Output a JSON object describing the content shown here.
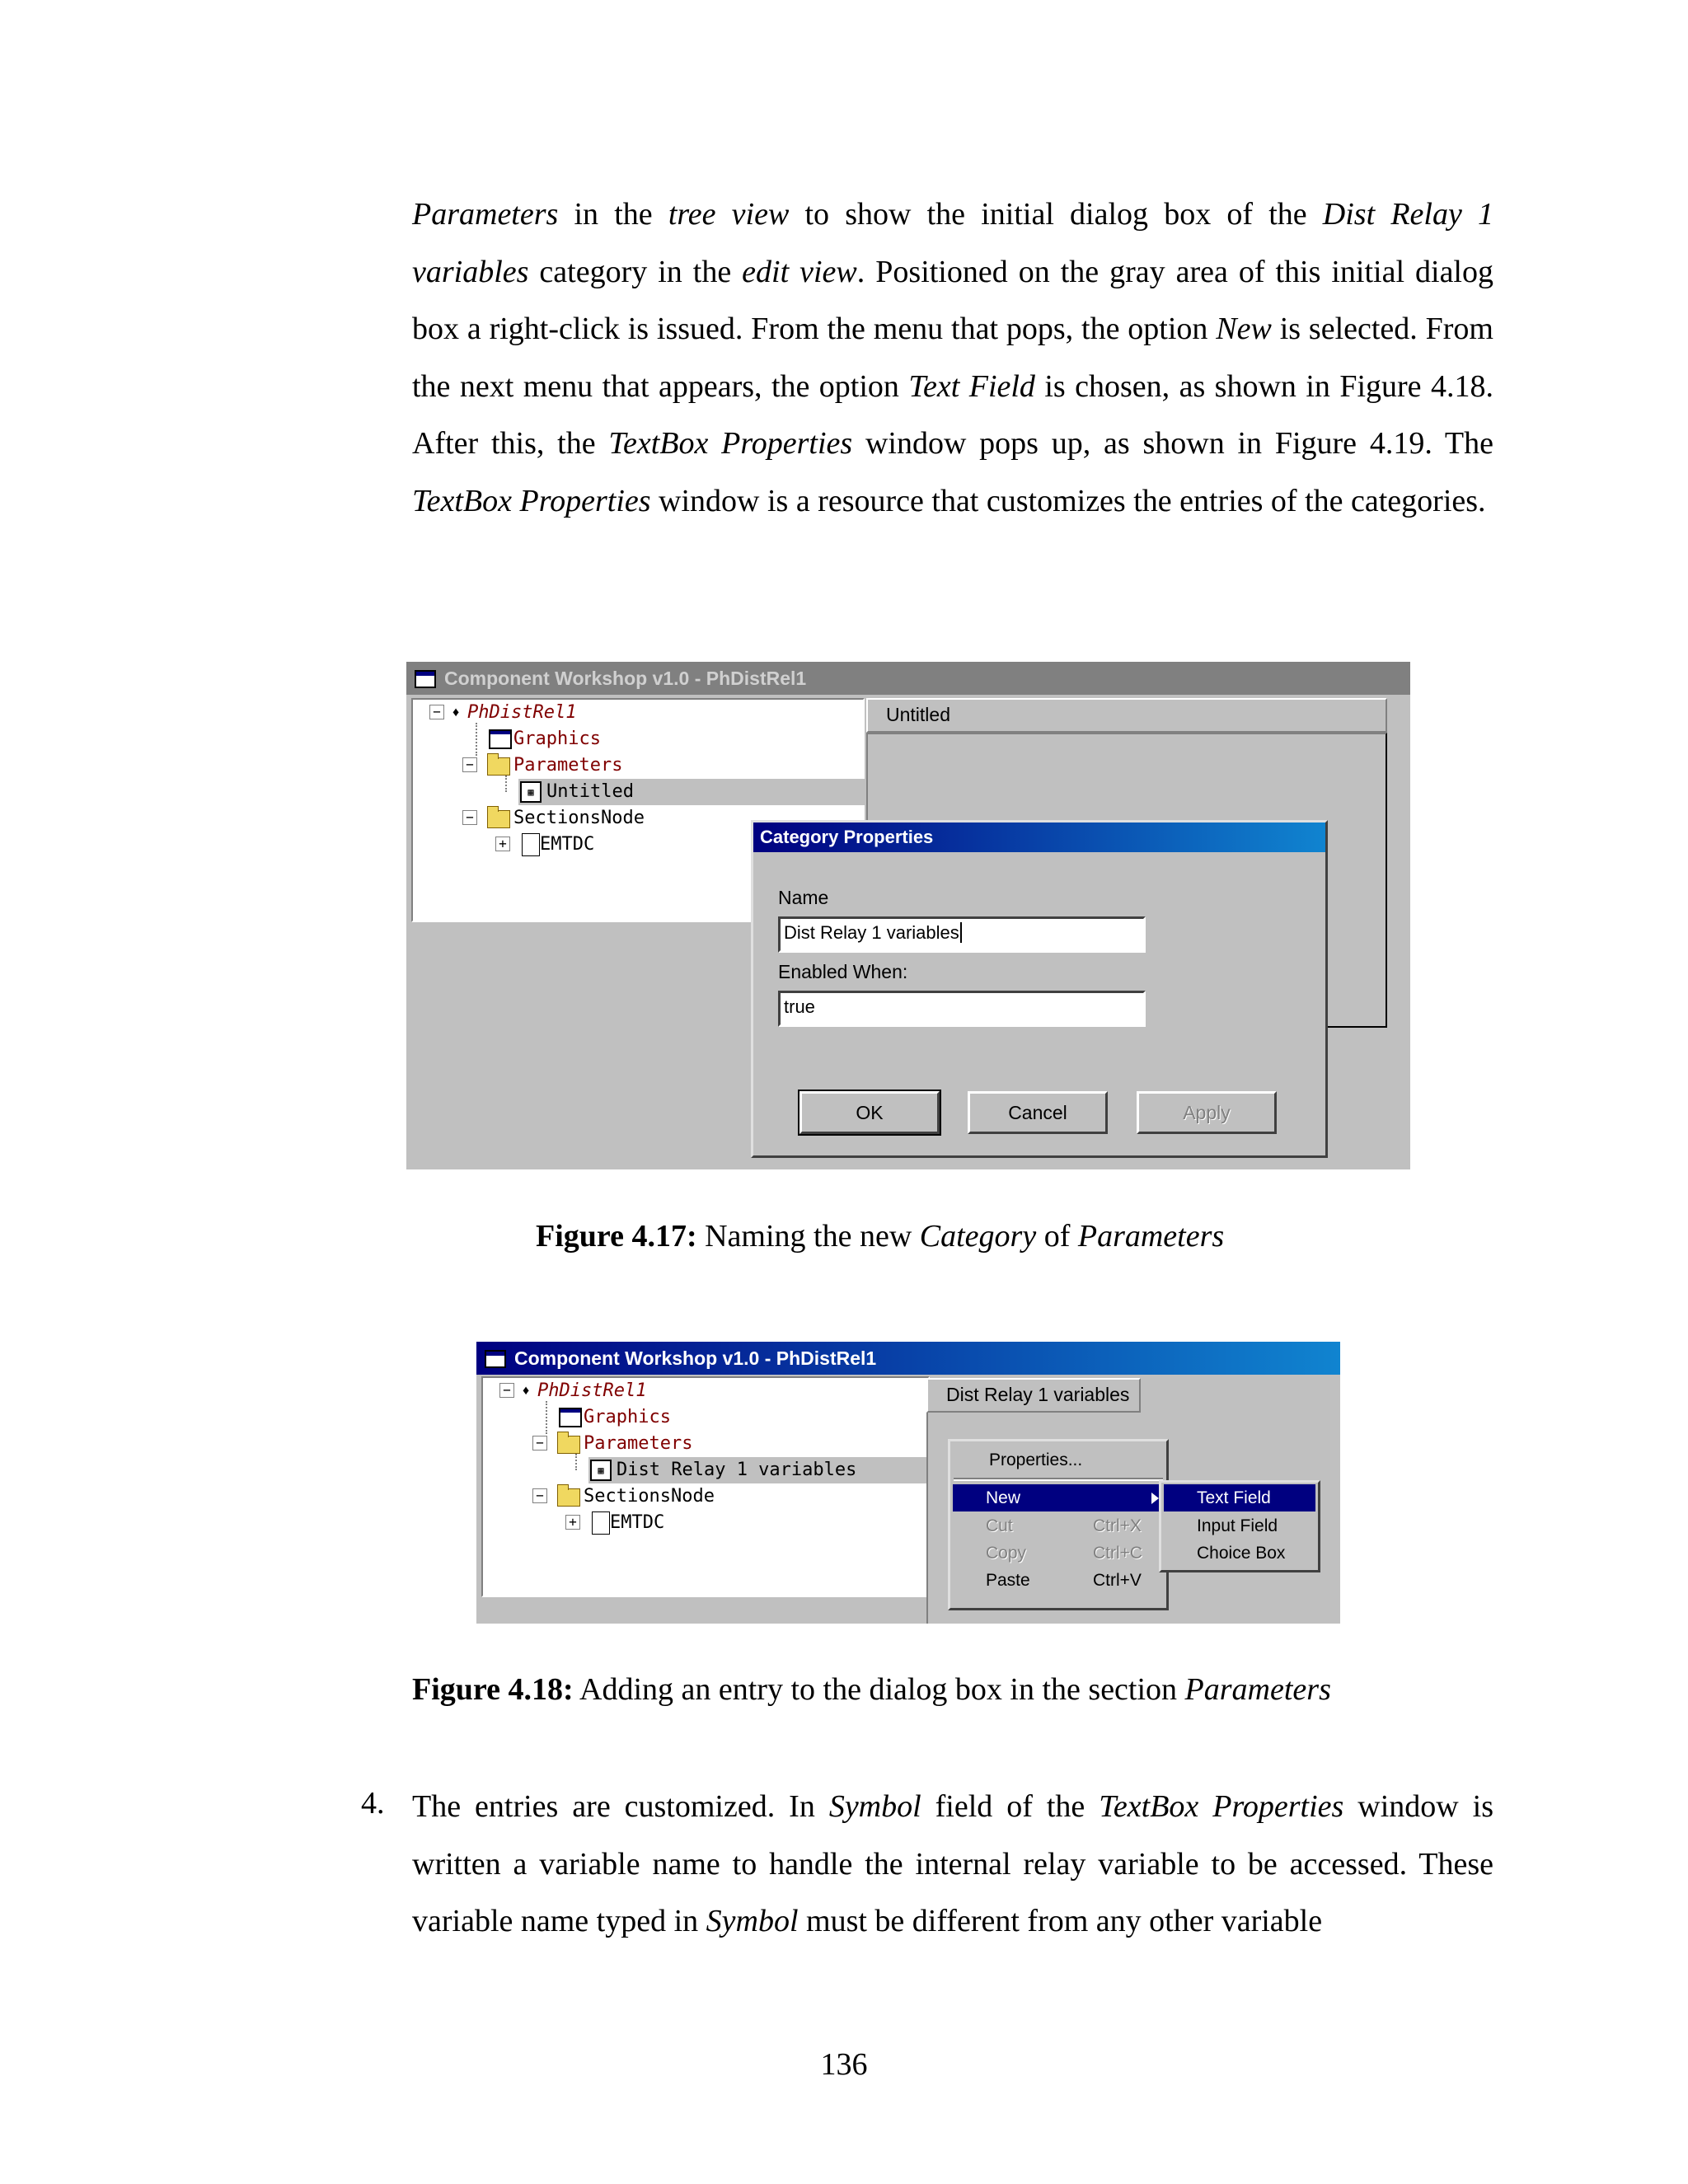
{
  "para1": [
    {
      "t": "Parameters",
      "i": true
    },
    {
      "t": " in the "
    },
    {
      "t": "tree view",
      "i": true
    },
    {
      "t": " to show the initial dialog box of the "
    },
    {
      "t": "Dist Relay 1 variables",
      "i": true
    },
    {
      "t": " category in the "
    },
    {
      "t": "edit view",
      "i": true
    },
    {
      "t": ".  Positioned on the gray area of this initial dialog box a right-click is issued.  From the menu that pops, the option "
    },
    {
      "t": "New",
      "i": true
    },
    {
      "t": " is selected.  From the next menu that appears, the option "
    },
    {
      "t": "Text Field",
      "i": true
    },
    {
      "t": " is chosen, as shown in Figure 4.18.  After this, the "
    },
    {
      "t": "TextBox Properties",
      "i": true
    },
    {
      "t": " window pops up, as shown in Figure 4.19.  The "
    },
    {
      "t": "TextBox Properties",
      "i": true
    },
    {
      "t": " window is a resource that customizes the entries of the categories."
    }
  ],
  "fig1": {
    "title": "Component Workshop v1.0 - PhDistRel1",
    "tree": {
      "root": "PhDistRel1",
      "graphics": "Graphics",
      "parameters": "Parameters",
      "untitled": "Untitled",
      "sections": "SectionsNode",
      "emtdc": "EMTDC"
    },
    "edit_header": "Untitled",
    "dialog": {
      "title": "Category Properties",
      "name_label": "Name",
      "name_value": "Dist Relay 1 variables",
      "enabled_label": "Enabled When:",
      "enabled_value": "true",
      "ok": "OK",
      "cancel": "Cancel",
      "apply": "Apply"
    },
    "caption_bold": "Figure 4.17:",
    "caption_parts": [
      {
        "t": "  Naming the new "
      },
      {
        "t": "Category",
        "i": true
      },
      {
        "t": " of "
      },
      {
        "t": "Parameters",
        "i": true
      }
    ]
  },
  "fig2": {
    "title": "Component Workshop v1.0 - PhDistRel1",
    "tree": {
      "root": "PhDistRel1",
      "graphics": "Graphics",
      "parameters": "Parameters",
      "category": "Dist Relay 1 variables",
      "sections": "SectionsNode",
      "emtdc": "EMTDC"
    },
    "edit_header": "Dist Relay 1 variables",
    "menu": [
      {
        "label": "Properties...",
        "shortcut": "",
        "state": "normal"
      },
      {
        "label": "New",
        "shortcut": "",
        "state": "highlight"
      },
      {
        "label": "Cut",
        "shortcut": "Ctrl+X",
        "state": "disabled"
      },
      {
        "label": "Copy",
        "shortcut": "Ctrl+C",
        "state": "disabled"
      },
      {
        "label": "Paste",
        "shortcut": "Ctrl+V",
        "state": "normal"
      }
    ],
    "submenu": [
      {
        "label": "Text Field",
        "state": "highlight"
      },
      {
        "label": "Input Field",
        "state": "normal"
      },
      {
        "label": "Choice Box",
        "state": "normal"
      }
    ],
    "caption_bold": "Figure 4.18:",
    "caption_parts": [
      {
        "t": "  Adding an entry to the dialog box in the section "
      },
      {
        "t": "Parameters",
        "i": true
      }
    ]
  },
  "list_number": "4.",
  "para2": [
    {
      "t": "The entries are customized.  In "
    },
    {
      "t": "Symbol",
      "i": true
    },
    {
      "t": " field of the "
    },
    {
      "t": "TextBox Properties",
      "i": true
    },
    {
      "t": " window is written a variable name to handle the internal relay variable to be accessed. These variable name typed in "
    },
    {
      "t": "Symbol",
      "i": true
    },
    {
      "t": " must be different from any other variable"
    }
  ],
  "page_number": "136",
  "colors": {
    "title_active": "#000080",
    "title_inactive": "#808080",
    "tree_text": "#800000"
  }
}
